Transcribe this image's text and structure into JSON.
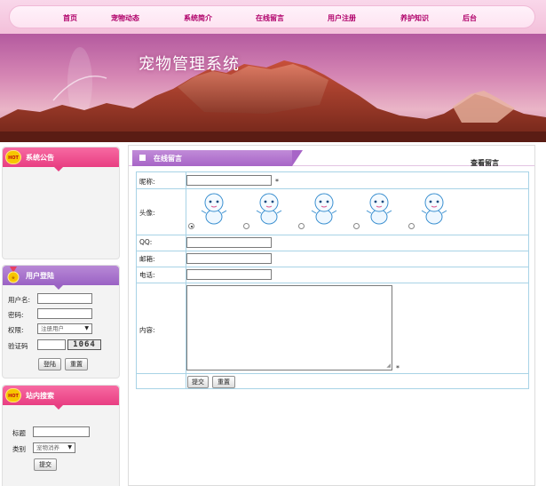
{
  "nav": {
    "items": [
      "首页",
      "宠物动态",
      "系统简介",
      "在线留言",
      "用户注册",
      "养护知识",
      "后台"
    ]
  },
  "banner": {
    "title": "宠物管理系统"
  },
  "sidebar": {
    "notice": {
      "title": "系统公告",
      "badge": "HOT"
    },
    "login": {
      "title": "用户登陆",
      "username_label": "用户名:",
      "password_label": "密码:",
      "role_label": "权限:",
      "role_value": "注册用户",
      "captcha_label": "验证码",
      "captcha_text": "1064",
      "login_button": "登陆",
      "reset_button": "重置"
    },
    "search": {
      "title": "站内搜索",
      "badge": "HOT",
      "title_label": "标题",
      "category_label": "类别",
      "category_value": "宠物消养",
      "submit_button": "提交"
    }
  },
  "main": {
    "tab_label": "在线留言",
    "view_link": "查看留言",
    "form": {
      "nickname_label": "昵称:",
      "avatar_label": "头像:",
      "qq_label": "QQ:",
      "email_label": "邮箱:",
      "phone_label": "电话:",
      "content_label": "内容:",
      "required_mark": "*",
      "avatar_count": 5,
      "selected_avatar": 1,
      "submit_button": "提交",
      "reset_button": "重置"
    }
  },
  "colors": {
    "nav_text": "#b0006a",
    "pink_header": "#e83e82",
    "purple_header": "#9a62c4",
    "table_border": "#a8d3e6"
  }
}
